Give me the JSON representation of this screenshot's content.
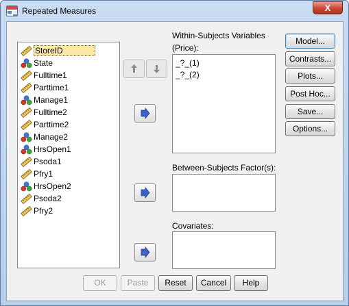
{
  "window": {
    "title": "Repeated Measures",
    "close_label": "X"
  },
  "variables": [
    {
      "label": "StoreID",
      "type": "scale",
      "selected": true
    },
    {
      "label": "State",
      "type": "nominal"
    },
    {
      "label": "Fulltime1",
      "type": "scale"
    },
    {
      "label": "Parttime1",
      "type": "scale"
    },
    {
      "label": "Manage1",
      "type": "nominal"
    },
    {
      "label": "Fulltime2",
      "type": "scale"
    },
    {
      "label": "Parttime2",
      "type": "scale"
    },
    {
      "label": "Manage2",
      "type": "nominal"
    },
    {
      "label": "HrsOpen1",
      "type": "nominal"
    },
    {
      "label": "Psoda1",
      "type": "scale"
    },
    {
      "label": "Pfry1",
      "type": "scale"
    },
    {
      "label": "HrsOpen2",
      "type": "nominal"
    },
    {
      "label": "Psoda2",
      "type": "scale"
    },
    {
      "label": "Pfry2",
      "type": "scale"
    }
  ],
  "within_subjects": {
    "label_line1": "Within-Subjects Variables",
    "label_line2": "(Price):",
    "items": [
      "_?_(1)",
      "_?_(2)"
    ]
  },
  "between_subjects": {
    "label": "Between-Subjects Factor(s):"
  },
  "covariates": {
    "label": "Covariates:"
  },
  "side_buttons": {
    "model": "Model...",
    "contrasts": "Contrasts...",
    "plots": "Plots...",
    "post_hoc": "Post Hoc...",
    "save": "Save...",
    "options": "Options..."
  },
  "bottom_buttons": {
    "ok": "OK",
    "paste": "Paste",
    "reset": "Reset",
    "cancel": "Cancel",
    "help": "Help"
  },
  "icons": {
    "scale": "ruler-icon",
    "nominal": "nominal-balls-icon",
    "move": "move-right-arrow-icon",
    "up": "move-up-arrow-icon",
    "down": "move-down-arrow-icon"
  },
  "colors": {
    "title_gradient": "#c9dcf3",
    "close_red": "#c8472f",
    "selection": "#fde9a6",
    "arrow_blue": "#3a62c8"
  }
}
